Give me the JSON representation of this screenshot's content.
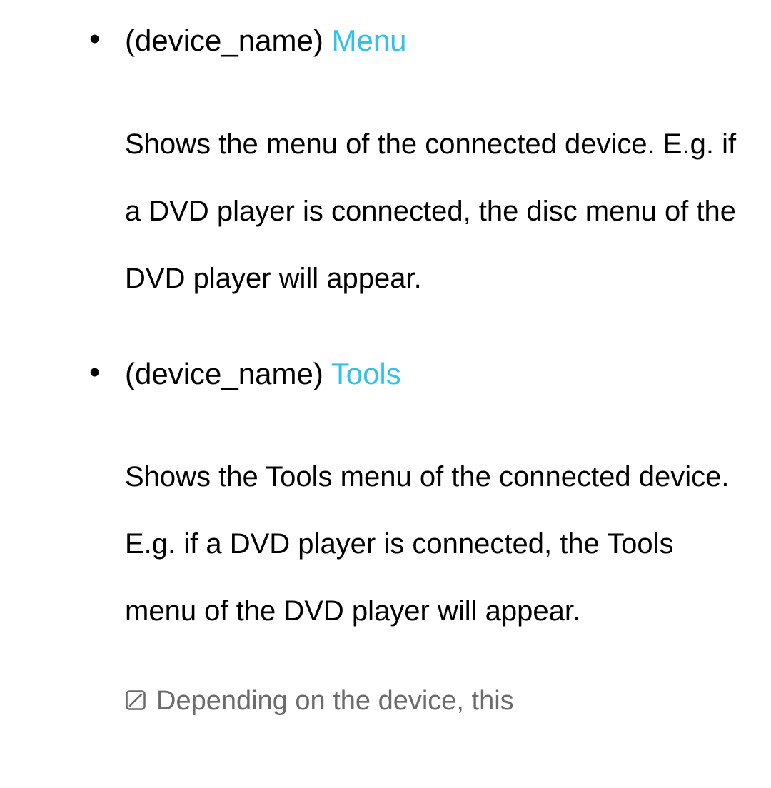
{
  "items": [
    {
      "prefix": "(device_name) ",
      "link": "Menu",
      "description": "Shows the menu of the connected device. E.g. if a DVD player is connected, the disc menu of the DVD player will appear."
    },
    {
      "prefix": "(device_name) ",
      "link": "Tools",
      "description": "Shows the Tools menu of the connected device. E.g. if a DVD player is connected, the Tools menu of the DVD player will appear."
    }
  ],
  "note": "Depending on the device, this"
}
